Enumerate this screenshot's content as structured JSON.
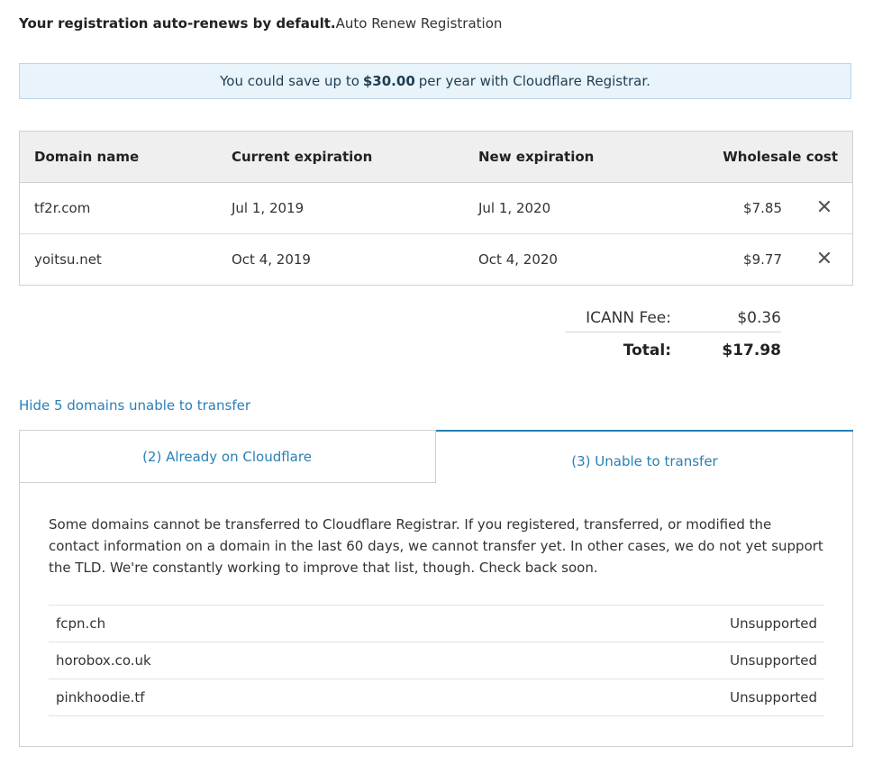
{
  "renew": {
    "bold_text": "Your registration auto-renews by default.",
    "label": "Auto Renew Registration"
  },
  "banner": {
    "prefix": "You could save up to",
    "amount": "$30.00",
    "suffix": "per year with Cloudflare Registrar."
  },
  "table": {
    "headers": {
      "domain": "Domain name",
      "current": "Current expiration",
      "new": "New expiration",
      "cost": "Wholesale cost"
    },
    "rows": [
      {
        "domain": "tf2r.com",
        "current": "Jul 1, 2019",
        "new": "Jul 1, 2020",
        "cost": "$7.85"
      },
      {
        "domain": "yoitsu.net",
        "current": "Oct 4, 2019",
        "new": "Oct 4, 2020",
        "cost": "$9.77"
      }
    ]
  },
  "totals": {
    "fee_label": "ICANN Fee:",
    "fee_value": "$0.36",
    "total_label": "Total:",
    "total_value": "$17.98"
  },
  "hide_link": "Hide 5 domains unable to transfer",
  "tabs": {
    "already": "(2) Already on Cloudflare",
    "unable": "(3) Unable to transfer"
  },
  "panel": {
    "description": "Some domains cannot be transferred to Cloudflare Registrar. If you registered, transferred, or modified the contact information on a domain in the last 60 days, we cannot transfer yet. In other cases, we do not yet support the TLD. We're constantly working to improve that list, though. Check back soon.",
    "items": [
      {
        "domain": "fcpn.ch",
        "status": "Unsupported"
      },
      {
        "domain": "horobox.co.uk",
        "status": "Unsupported"
      },
      {
        "domain": "pinkhoodie.tf",
        "status": "Unsupported"
      }
    ]
  },
  "icons": {
    "remove": "close-icon"
  },
  "colors": {
    "link": "#2a7fb8",
    "banner_bg": "#e8f3fa",
    "header_bg": "#eeefee"
  }
}
